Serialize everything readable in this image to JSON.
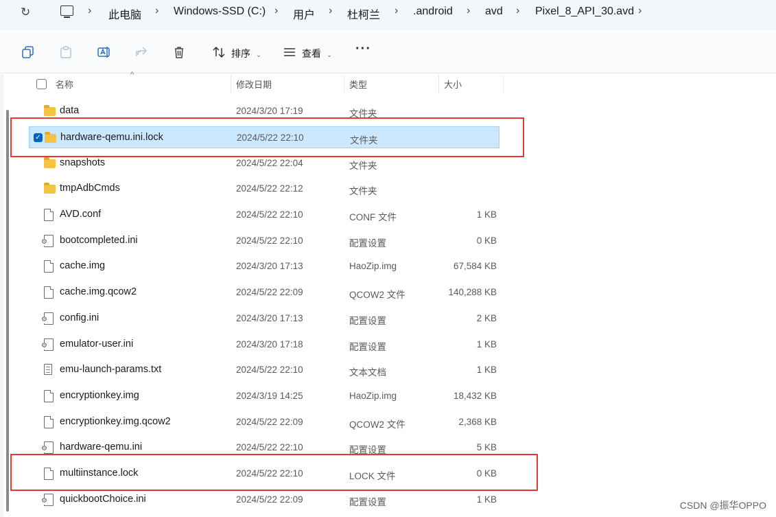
{
  "address_bar": {
    "crumbs": [
      "此电脑",
      "Windows-SSD (C:)",
      "用户",
      "杜柯兰",
      ".android",
      "avd",
      "Pixel_8_API_30.avd"
    ]
  },
  "toolbar": {
    "sort_label": "排序",
    "view_label": "查看"
  },
  "columns": {
    "name": "名称",
    "date": "修改日期",
    "type": "类型",
    "size": "大小"
  },
  "files": [
    {
      "name": "data",
      "date": "2024/3/20 17:19",
      "type": "文件夹",
      "size": "",
      "icon": "folder-icon"
    },
    {
      "name": "hardware-qemu.ini.lock",
      "date": "2024/5/22 22:10",
      "type": "文件夹",
      "size": "",
      "icon": "folder-icon",
      "selected": true
    },
    {
      "name": "snapshots",
      "date": "2024/5/22 22:04",
      "type": "文件夹",
      "size": "",
      "icon": "folder-icon"
    },
    {
      "name": "tmpAdbCmds",
      "date": "2024/5/22 22:12",
      "type": "文件夹",
      "size": "",
      "icon": "folder-icon"
    },
    {
      "name": "AVD.conf",
      "date": "2024/5/22 22:10",
      "type": "CONF 文件",
      "size": "1 KB",
      "icon": "file-icon"
    },
    {
      "name": "bootcompleted.ini",
      "date": "2024/5/22 22:10",
      "type": "配置设置",
      "size": "0 KB",
      "icon": "config-file-icon"
    },
    {
      "name": "cache.img",
      "date": "2024/3/20 17:13",
      "type": "HaoZip.img",
      "size": "67,584 KB",
      "icon": "file-icon"
    },
    {
      "name": "cache.img.qcow2",
      "date": "2024/5/22 22:09",
      "type": "QCOW2 文件",
      "size": "140,288 KB",
      "icon": "file-icon"
    },
    {
      "name": "config.ini",
      "date": "2024/3/20 17:13",
      "type": "配置设置",
      "size": "2 KB",
      "icon": "config-file-icon"
    },
    {
      "name": "emulator-user.ini",
      "date": "2024/3/20 17:18",
      "type": "配置设置",
      "size": "1 KB",
      "icon": "config-file-icon"
    },
    {
      "name": "emu-launch-params.txt",
      "date": "2024/5/22 22:10",
      "type": "文本文档",
      "size": "1 KB",
      "icon": "text-file-icon"
    },
    {
      "name": "encryptionkey.img",
      "date": "2024/3/19 14:25",
      "type": "HaoZip.img",
      "size": "18,432 KB",
      "icon": "file-icon"
    },
    {
      "name": "encryptionkey.img.qcow2",
      "date": "2024/5/22 22:09",
      "type": "QCOW2 文件",
      "size": "2,368 KB",
      "icon": "file-icon"
    },
    {
      "name": "hardware-qemu.ini",
      "date": "2024/5/22 22:10",
      "type": "配置设置",
      "size": "5 KB",
      "icon": "config-file-icon"
    },
    {
      "name": "multiinstance.lock",
      "date": "2024/5/22 22:10",
      "type": "LOCK 文件",
      "size": "0 KB",
      "icon": "file-icon"
    },
    {
      "name": "quickbootChoice.ini",
      "date": "2024/5/22 22:09",
      "type": "配置设置",
      "size": "1 KB",
      "icon": "config-file-icon"
    }
  ],
  "watermark": "CSDN @振华OPPO",
  "colors": {
    "selection": "#cce8ff",
    "highlight_box": "#e53935",
    "folder": "#f5c242"
  }
}
